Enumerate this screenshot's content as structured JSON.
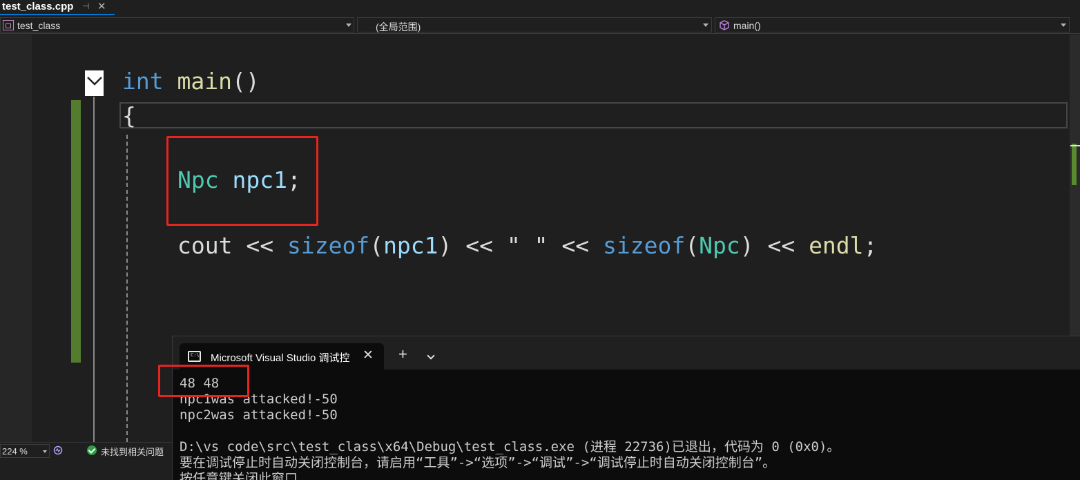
{
  "tab": {
    "filename": "test_class.cpp",
    "pin_icon": "pin-icon",
    "close_icon": "close-icon"
  },
  "nav": {
    "project": "test_class",
    "scope": "(全局范围)",
    "member": "main()"
  },
  "code": {
    "line1": {
      "kw": "int",
      "fn": "main",
      "paren": "()"
    },
    "line2": {
      "brace": "{"
    },
    "line3": {
      "type": "Npc",
      "var": "npc1",
      "semi": ";"
    },
    "line4": {
      "t1": "cout",
      "op1": " << ",
      "kw1": "sizeof",
      "p1": "(",
      "v1": "npc1",
      "p2": ")",
      "op2": " << ",
      "s": "\" \"",
      "op3": " << ",
      "kw2": "sizeof",
      "p3": "(",
      "ty": "Npc",
      "p4": ")",
      "op4": " << ",
      "fn": "endl",
      "semi": ";"
    }
  },
  "console": {
    "tab_title": "Microsoft Visual Studio 调试控",
    "output": [
      "48 48",
      "npc1was attacked!-50",
      "npc2was attacked!-50",
      "",
      "D:\\vs code\\src\\test_class\\x64\\Debug\\test_class.exe (进程 22736)已退出，代码为 0 (0x0)。",
      "要在调试停止时自动关闭控制台，请启用“工具”->“选项”->“调试”->“调试停止时自动关闭控制台”。",
      "按任意键关闭此窗口. . ."
    ]
  },
  "status": {
    "zoom": "224 %",
    "issues": "未找到相关问题"
  },
  "colors": {
    "keyword": "#569cd6",
    "function": "#dcdcaa",
    "type": "#4ec9b0",
    "variable": "#9cdcfe",
    "string": "#d69d85",
    "annotation": "#e8241f",
    "change_bar": "#547c2f"
  }
}
